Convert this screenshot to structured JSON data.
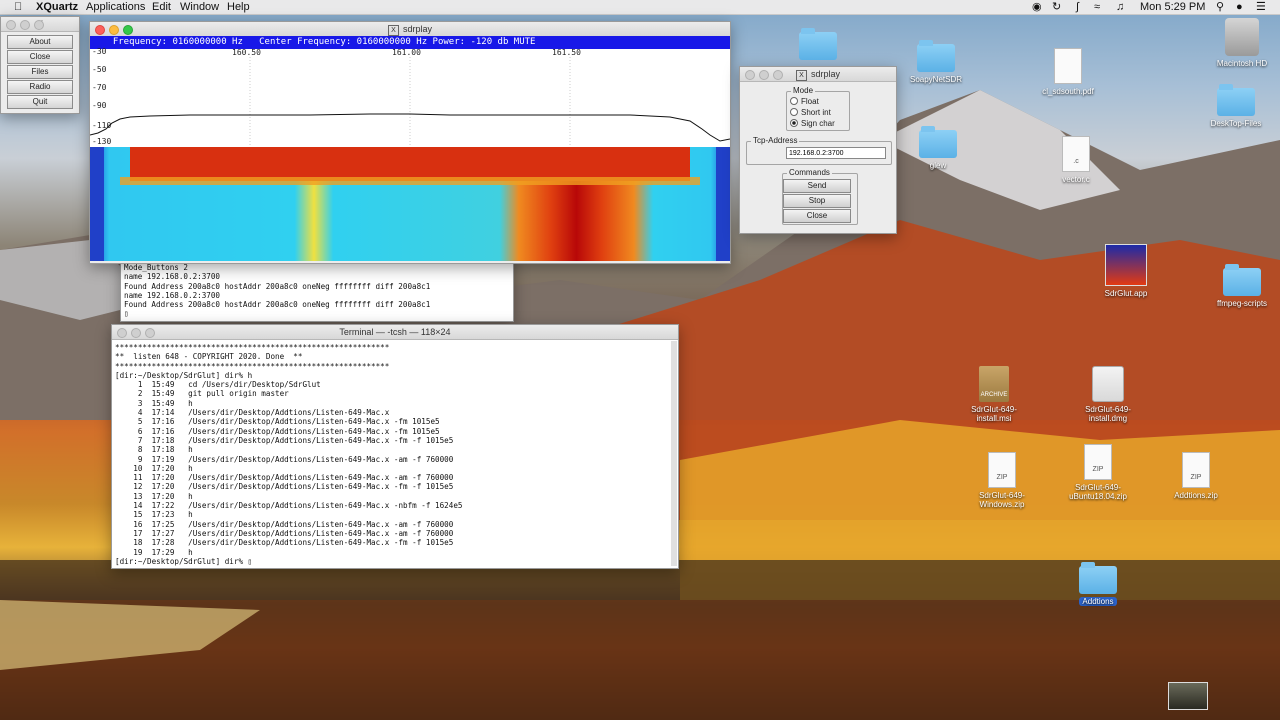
{
  "menubar": {
    "app": "XQuartz",
    "items": [
      "Applications",
      "Edit",
      "Window",
      "Help"
    ],
    "clock": "Mon 5:29 PM"
  },
  "xquartz_menu": {
    "title": "X",
    "buttons": [
      "About",
      "Close",
      "Files",
      "Radio",
      "Quit"
    ]
  },
  "sdrplay": {
    "title": "sdrplay",
    "status": "  Frequency: 0160000000 Hz   Center Frequency: 0160000000 Hz Power: -120 db MUTE",
    "x_ticks": [
      "160.50",
      "161.00",
      "161.50"
    ],
    "y_ticks": [
      "-30",
      "-50",
      "-70",
      "-90",
      "-110",
      "-130"
    ]
  },
  "sdrplay_panel": {
    "title": "sdrplay",
    "mode_label": "Mode",
    "modes": [
      "Float",
      "Short int",
      "Sign char"
    ],
    "selected_mode": "Sign char",
    "tcp_label": "Tcp-Address",
    "tcp_value": "192.168.0.2:3700",
    "commands_label": "Commands",
    "commands": [
      "Send",
      "Stop",
      "Close"
    ]
  },
  "terminal_back": {
    "lines": [
      "Mode_Buttons 2",
      "name 192.168.0.2:3700",
      "Found Address 200a8c0 hostAddr 200a8c0 oneNeg ffffffff diff 200a8c1",
      "name 192.168.0.2:3700",
      "Found Address 200a8c0 hostAddr 200a8c0 oneNeg ffffffff diff 200a8c1",
      "▯"
    ]
  },
  "terminal": {
    "title": "Terminal — -tcsh — 118×24",
    "lines": [
      "************************************************************",
      "**  listen 648 - COPYRIGHT 2020. Done  **",
      "************************************************************",
      "[dir:~/Desktop/SdrGlut] dir% h",
      "     1  15:49   cd /Users/dir/Desktop/SdrGlut",
      "     2  15:49   git pull origin master",
      "     3  15:49   h",
      "     4  17:14   /Users/dir/Desktop/Addtions/Listen-649-Mac.x",
      "     5  17:16   /Users/dir/Desktop/Addtions/Listen-649-Mac.x -fm 1015e5",
      "     6  17:16   /Users/dir/Desktop/Addtions/Listen-649-Mac.x -fm 1015e5",
      "     7  17:18   /Users/dir/Desktop/Addtions/Listen-649-Mac.x -fm -f 1015e5",
      "     8  17:18   h",
      "     9  17:19   /Users/dir/Desktop/Addtions/Listen-649-Mac.x -am -f 760000",
      "    10  17:20   h",
      "    11  17:20   /Users/dir/Desktop/Addtions/Listen-649-Mac.x -am -f 760000",
      "    12  17:20   /Users/dir/Desktop/Addtions/Listen-649-Mac.x -fm -f 1015e5",
      "    13  17:20   h",
      "    14  17:22   /Users/dir/Desktop/Addtions/Listen-649-Mac.x -nbfm -f 1624e5",
      "    15  17:23   h",
      "    16  17:25   /Users/dir/Desktop/Addtions/Listen-649-Mac.x -am -f 760000",
      "    17  17:27   /Users/dir/Desktop/Addtions/Listen-649-Mac.x -am -f 760000",
      "    18  17:28   /Users/dir/Desktop/Addtions/Listen-649-Mac.x -fm -f 1015e5",
      "    19  17:29   h",
      "[dir:~/Desktop/SdrGlut] dir% ▯"
    ]
  },
  "desktop_icons": [
    {
      "label": "Macintosh HD",
      "kind": "hdd-icon"
    },
    {
      "label": "SoapyNetSDR",
      "kind": "folder-icon"
    },
    {
      "label": "cl_sdsouth.pdf",
      "kind": "document-icon"
    },
    {
      "label": "DeskTop-Files",
      "kind": "folder-icon"
    },
    {
      "label": "glew",
      "kind": "folder-icon"
    },
    {
      "label": "vector.c",
      "kind": "document-icon"
    },
    {
      "label": "SdrGlut.app",
      "kind": "app-icon"
    },
    {
      "label": "ffmpeg-scripts",
      "kind": "folder-icon"
    },
    {
      "label": "SdrGlut-649-install.msi",
      "kind": "archive-icon"
    },
    {
      "label": "SdrGlut-649-install.dmg",
      "kind": "disk-image-icon"
    },
    {
      "label": "SdrGlut-649-Windows.zip",
      "kind": "zip-icon"
    },
    {
      "label": "SdrGlut-649-uBuntu18.04.zip",
      "kind": "zip-icon"
    },
    {
      "label": "Addtions.zip",
      "kind": "zip-icon"
    },
    {
      "label": "Addtions",
      "kind": "folder-icon"
    }
  ],
  "colors": {
    "status_bar": "#1818e8",
    "waterfall_high": "#d41010",
    "waterfall_low": "#30c8f0"
  }
}
